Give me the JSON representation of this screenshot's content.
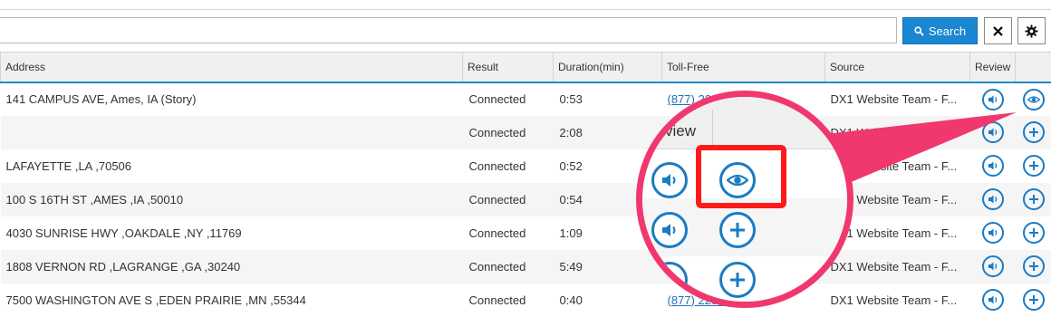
{
  "search": {
    "placeholder": "",
    "value": "",
    "button_label": "Search"
  },
  "toolbar": {
    "close_icon": "close-icon",
    "settings_icon": "gear-icon"
  },
  "table": {
    "headers": {
      "address": "Address",
      "result": "Result",
      "duration": "Duration(min)",
      "toll_free": "Toll-Free",
      "source": "Source",
      "review": "Review"
    },
    "rows": [
      {
        "address": "141 CAMPUS AVE, Ames, IA (Story)",
        "result": "Connected",
        "duration": "0:53",
        "toll_free": "(877) 220-9906",
        "source": "DX1 Website Team - F..."
      },
      {
        "address": "",
        "result": "Connected",
        "duration": "2:08",
        "toll_free": "",
        "source": "DX1 Website Team - F..."
      },
      {
        "address": "LAFAYETTE ,LA ,70506",
        "result": "Connected",
        "duration": "0:52",
        "toll_free": "",
        "source": "DX1 Website Team - F..."
      },
      {
        "address": "100 S 16TH ST ,AMES ,IA ,50010",
        "result": "Connected",
        "duration": "0:54",
        "toll_free": "",
        "source": "DX1 Website Team - F..."
      },
      {
        "address": "4030 SUNRISE HWY ,OAKDALE ,NY ,11769",
        "result": "Connected",
        "duration": "1:09",
        "toll_free": "",
        "source": "DX1 Website Team - F..."
      },
      {
        "address": "1808 VERNON RD ,LAGRANGE ,GA ,30240",
        "result": "Connected",
        "duration": "5:49",
        "toll_free": "",
        "source": "DX1 Website Team - F..."
      },
      {
        "address": "7500 WASHINGTON AVE S ,EDEN PRAIRIE ,MN ,55344",
        "result": "Connected",
        "duration": "0:40",
        "toll_free": "(877) 220-9906",
        "source": "DX1 Website Team - F..."
      }
    ]
  },
  "magnifier": {
    "header_fragment": "view"
  },
  "colors": {
    "accent": "#1b86d1",
    "highlight": "#ff1a1a",
    "callout": "#f0386e"
  }
}
